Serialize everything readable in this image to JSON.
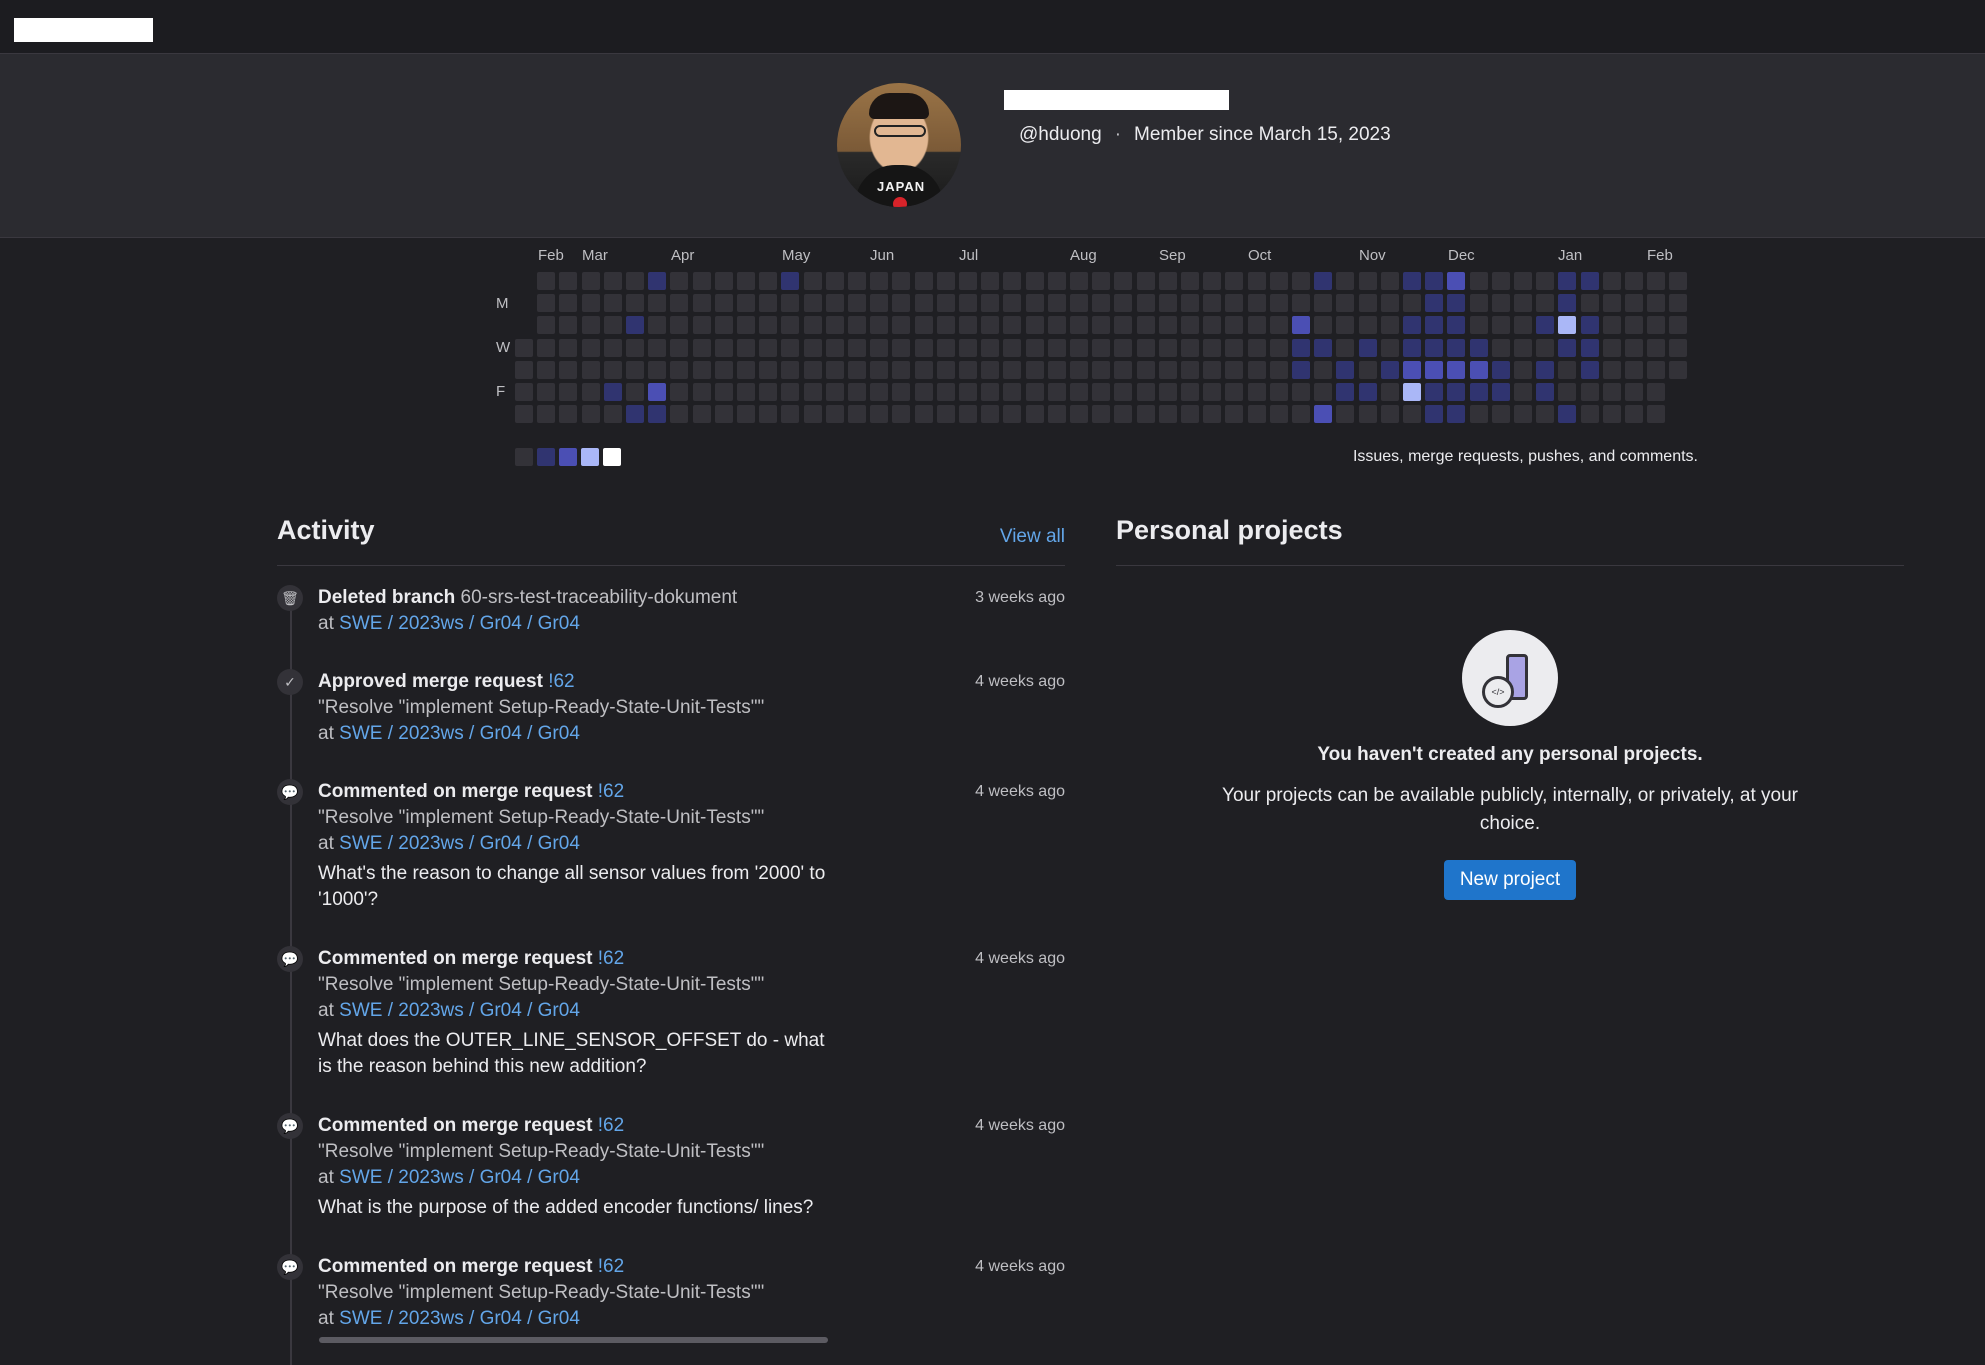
{
  "profile": {
    "username": "@hduong",
    "separator": "·",
    "member_since": "Member since March 15, 2023",
    "avatar_shirt_text": "JAPAN"
  },
  "graph": {
    "months": [
      "Feb",
      "Mar",
      "Apr",
      "May",
      "Jun",
      "Jul",
      "Aug",
      "Sep",
      "Oct",
      "Nov",
      "Dec",
      "Jan",
      "Feb"
    ],
    "day_labels": [
      "M",
      "W",
      "F"
    ],
    "caption": "Issues, merge requests, pushes, and comments.",
    "colors": {
      "0": "#333238",
      "1": "#303470",
      "2": "#4b4fb4",
      "3": "#6e80ee",
      "4": "#aab7f7",
      "legend_top": "#ffffff"
    }
  },
  "activity": {
    "title": "Activity",
    "view_all": "View all",
    "events": [
      {
        "icon": "trash-icon",
        "icon_glyph": "🗑",
        "action": "Deleted branch",
        "target": "60-srs-test-traceability-dokument",
        "target_is_link": false,
        "title": "",
        "at_label": "at",
        "project": "SWE / 2023ws / Gr04 / Gr04",
        "note": "",
        "time": "3 weeks ago"
      },
      {
        "icon": "check-icon",
        "icon_glyph": "✓",
        "action": "Approved merge request",
        "target": "!62",
        "target_is_link": true,
        "title": "\"Resolve \"implement Setup-Ready-State-Unit-Tests\"\"",
        "at_label": "at",
        "project": "SWE / 2023ws / Gr04 / Gr04",
        "note": "",
        "time": "4 weeks ago"
      },
      {
        "icon": "comment-icon",
        "icon_glyph": "💬",
        "action": "Commented on merge request",
        "target": "!62",
        "target_is_link": true,
        "title": "\"Resolve \"implement Setup-Ready-State-Unit-Tests\"\"",
        "at_label": "at",
        "project": "SWE / 2023ws / Gr04 / Gr04",
        "note": "What's the reason to change all sensor values from '2000' to '1000'?",
        "time": "4 weeks ago"
      },
      {
        "icon": "comment-icon",
        "icon_glyph": "💬",
        "action": "Commented on merge request",
        "target": "!62",
        "target_is_link": true,
        "title": "\"Resolve \"implement Setup-Ready-State-Unit-Tests\"\"",
        "at_label": "at",
        "project": "SWE / 2023ws / Gr04 / Gr04",
        "note": "What does the OUTER_LINE_SENSOR_OFFSET do - what is the reason behind this new addition?",
        "time": "4 weeks ago"
      },
      {
        "icon": "comment-icon",
        "icon_glyph": "💬",
        "action": "Commented on merge request",
        "target": "!62",
        "target_is_link": true,
        "title": "\"Resolve \"implement Setup-Ready-State-Unit-Tests\"\"",
        "at_label": "at",
        "project": "SWE / 2023ws / Gr04 / Gr04",
        "note": "What is the purpose of the added encoder functions/ lines?",
        "time": "4 weeks ago"
      },
      {
        "icon": "comment-icon",
        "icon_glyph": "💬",
        "action": "Commented on merge request",
        "target": "!62",
        "target_is_link": true,
        "title": "\"Resolve \"implement Setup-Ready-State-Unit-Tests\"\"",
        "at_label": "at",
        "project": "SWE / 2023ws / Gr04 / Gr04",
        "note": "",
        "time": "4 weeks ago"
      }
    ]
  },
  "projects": {
    "title": "Personal projects",
    "empty_title": "You haven't created any personal projects.",
    "empty_text": "Your projects can be available publicly, internally, or privately, at your choice.",
    "new_project": "New project",
    "illustration_code": "</>"
  }
}
